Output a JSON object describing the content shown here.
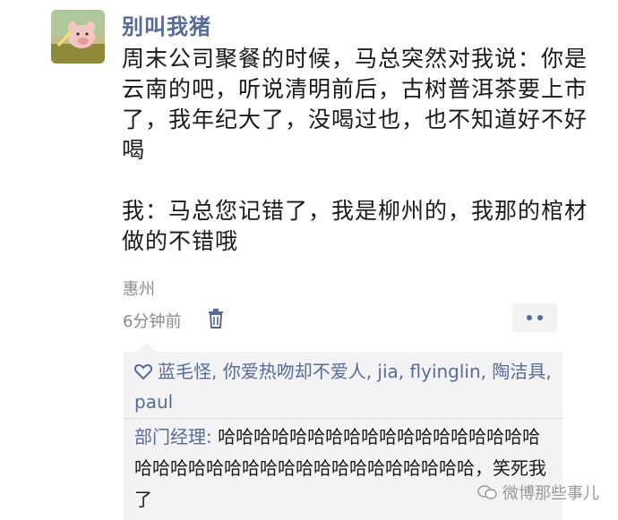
{
  "post": {
    "author": "别叫我猪",
    "text": "周末公司聚餐的时候，马总突然对我说：你是云南的吧，听说清明前后，古树普洱茶要上市了，我年纪大了，没喝过也，也不知道好不好喝\n\n我：马总您记错了，我是柳州的，我那的棺材做的不错哦",
    "location": "惠州",
    "time": "6分钟前"
  },
  "likes": {
    "names": "蓝毛怪, 你爱热吻却不爱人, jia, flyinglin, 陶洁具, paul"
  },
  "comment": {
    "commenter": "部门经理",
    "separator": ": ",
    "text": "哈哈哈哈哈哈哈哈哈哈哈哈哈哈哈哈哈哈哈哈哈哈哈哈哈哈哈哈哈哈哈哈哈哈哈哈哈，笑死我了"
  },
  "watermark": {
    "brand": "微博那些事儿"
  },
  "icons": {
    "delete": "trash-icon",
    "more": "more-dots-icon",
    "like": "heart-icon"
  },
  "colors": {
    "link": "#576b95",
    "comment_bg": "#f3f3f5",
    "meta_text": "#8a8a8a"
  }
}
